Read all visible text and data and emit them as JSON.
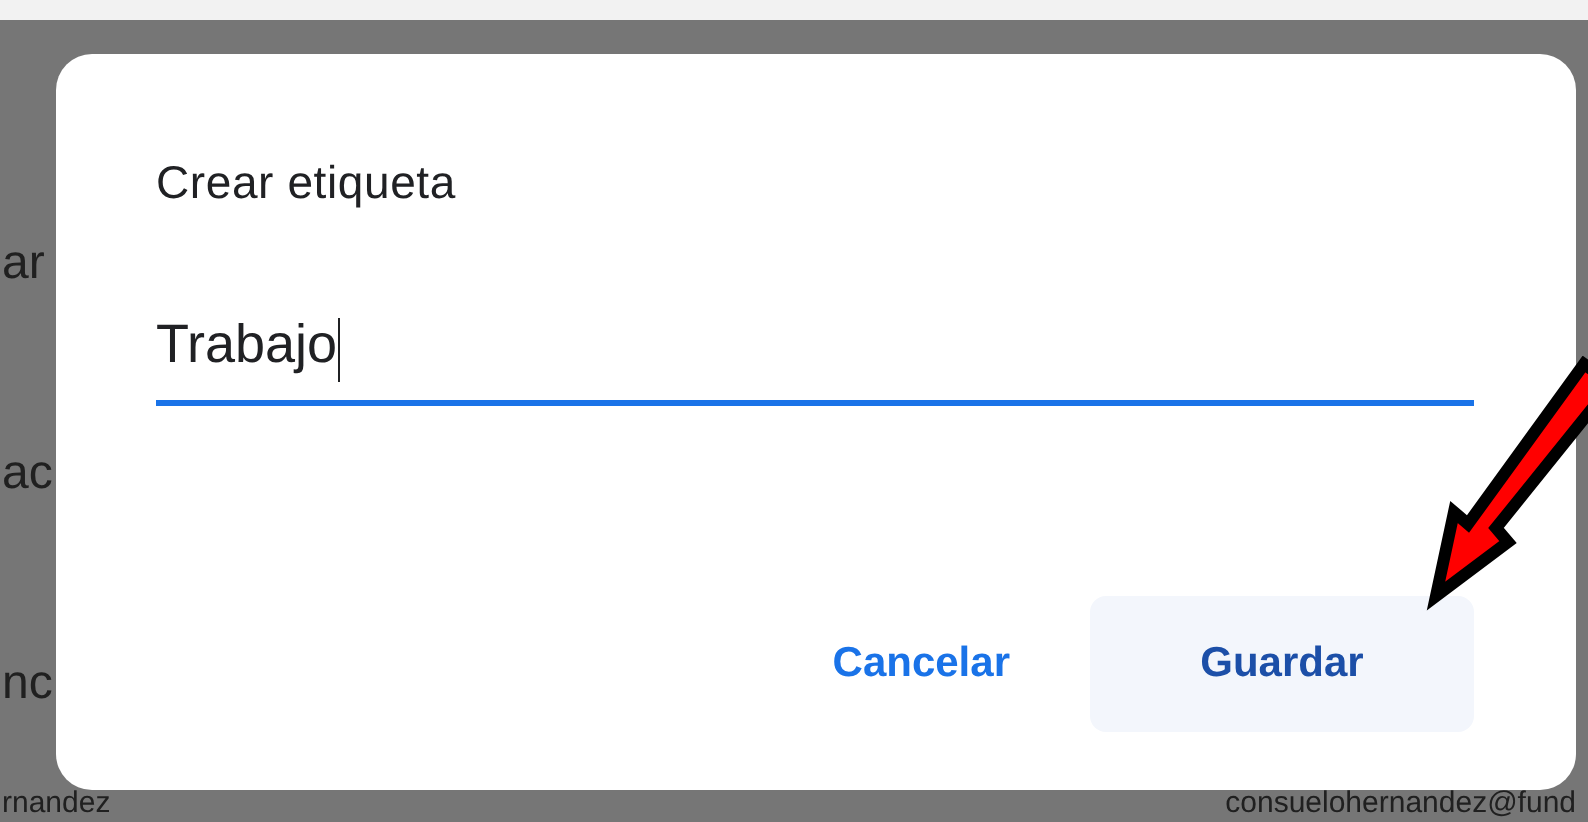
{
  "background_rows": [
    {
      "name": "ar"
    },
    {
      "name": "ac"
    },
    {
      "name": "nc"
    },
    {
      "name": "rnandez",
      "email": "consuelohernandez@fund"
    }
  ],
  "dialog": {
    "title": "Crear etiqueta",
    "field": {
      "value": "Trabajo",
      "focused": true
    },
    "buttons": [
      {
        "label": "Cancelar",
        "kind": "text"
      },
      {
        "label": "Guardar",
        "kind": "tonal"
      }
    ]
  },
  "annotation": {
    "kind": "arrow"
  }
}
